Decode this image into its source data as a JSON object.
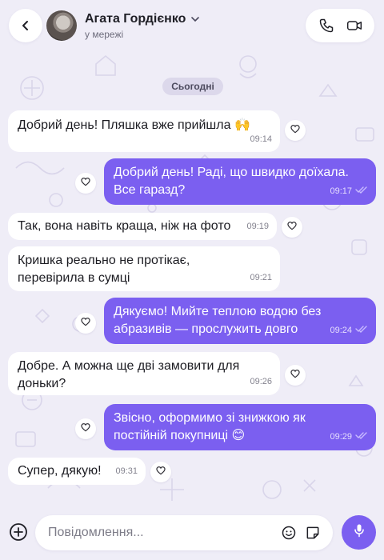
{
  "header": {
    "contact_name": "Агата Гордієнко",
    "status": "у мережі"
  },
  "date_separator": "Сьогодні",
  "messages": [
    {
      "direction": "in",
      "lines": [
        "Добрий день! Пляшка вже прийшла 🙌"
      ],
      "time": "09:14"
    },
    {
      "direction": "out",
      "lines": [
        "Добрий день! Раді, що швидко доїхала.",
        "Все гаразд?"
      ],
      "time": "09:17",
      "read": true
    },
    {
      "direction": "in",
      "lines": [
        "Так, вона навіть краща, ніж на фото"
      ],
      "time": "09:19"
    },
    {
      "direction": "in",
      "lines": [
        "Кришка реально не протікає,",
        "перевірила в сумці"
      ],
      "time": "09:21"
    },
    {
      "direction": "out",
      "lines": [
        "Дякуємо! Мийте теплою водою без",
        "абразивів — прослужить довго"
      ],
      "time": "09:24",
      "read": true
    },
    {
      "direction": "in",
      "lines": [
        "Добре. А можна ще дві замовити для",
        "доньки?"
      ],
      "time": "09:26"
    },
    {
      "direction": "out",
      "lines": [
        "Звісно, оформимо зі знижкою як",
        "постійній покупниці 😊"
      ],
      "time": "09:29",
      "read": true
    },
    {
      "direction": "in",
      "lines": [
        "Супер, дякую!"
      ],
      "time": "09:31"
    }
  ],
  "composer": {
    "placeholder": "Повідомлення..."
  },
  "colors": {
    "accent": "#7b5ff0",
    "background": "#efedf7",
    "incoming_bubble": "#ffffff"
  },
  "icons": [
    "back-arrow-icon",
    "chevron-down-icon",
    "phone-icon",
    "video-camera-icon",
    "heart-icon",
    "double-check-icon",
    "plus-circle-icon",
    "smile-icon",
    "sticker-icon",
    "microphone-icon"
  ]
}
